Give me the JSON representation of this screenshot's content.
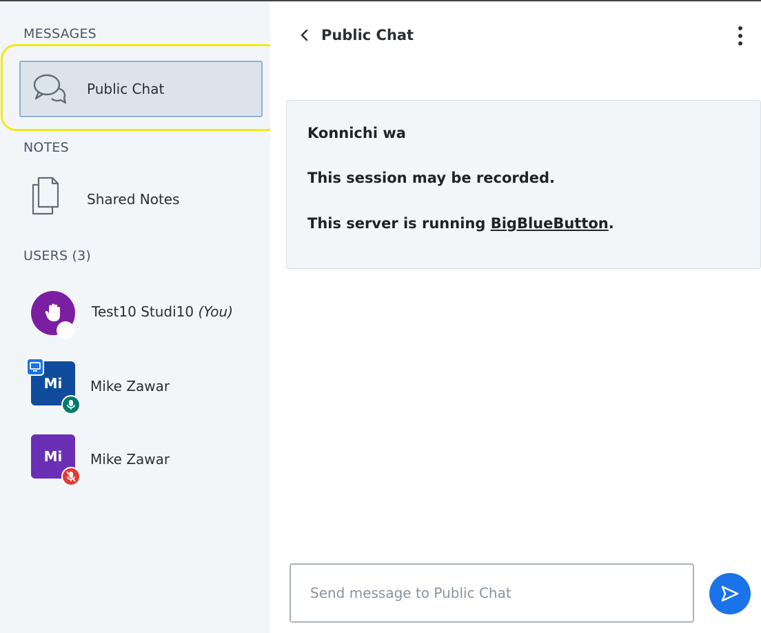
{
  "sidebar": {
    "messages_title": "MESSAGES",
    "public_chat_label": "Public Chat",
    "notes_title": "NOTES",
    "shared_notes_label": "Shared Notes",
    "users_title": "USERS (3)",
    "users": [
      {
        "name": "Test10 Studi10",
        "suffix": "(You)",
        "initials": "",
        "avatar_color": "#7b1fa2",
        "status": "raised-hand"
      },
      {
        "name": "Mike Zawar",
        "suffix": "",
        "initials": "Mi",
        "avatar_color": "#0f4c9c",
        "status": "presenter, mic-on"
      },
      {
        "name": "Mike Zawar",
        "suffix": "",
        "initials": "Mi",
        "avatar_color": "#6a2fb5",
        "status": "mic-muted"
      }
    ]
  },
  "chat": {
    "title": "Public Chat",
    "welcome_lines": [
      "Konnichi wa",
      "This session may be recorded."
    ],
    "server_text": "This server is running ",
    "server_link": "BigBlueButton",
    "server_end": ".",
    "input_placeholder": "Send message to Public Chat"
  },
  "colors": {
    "highlight": "#f2ea13",
    "accent": "#1a73e8",
    "mic_on": "#00796b",
    "mic_muted": "#e53935"
  }
}
